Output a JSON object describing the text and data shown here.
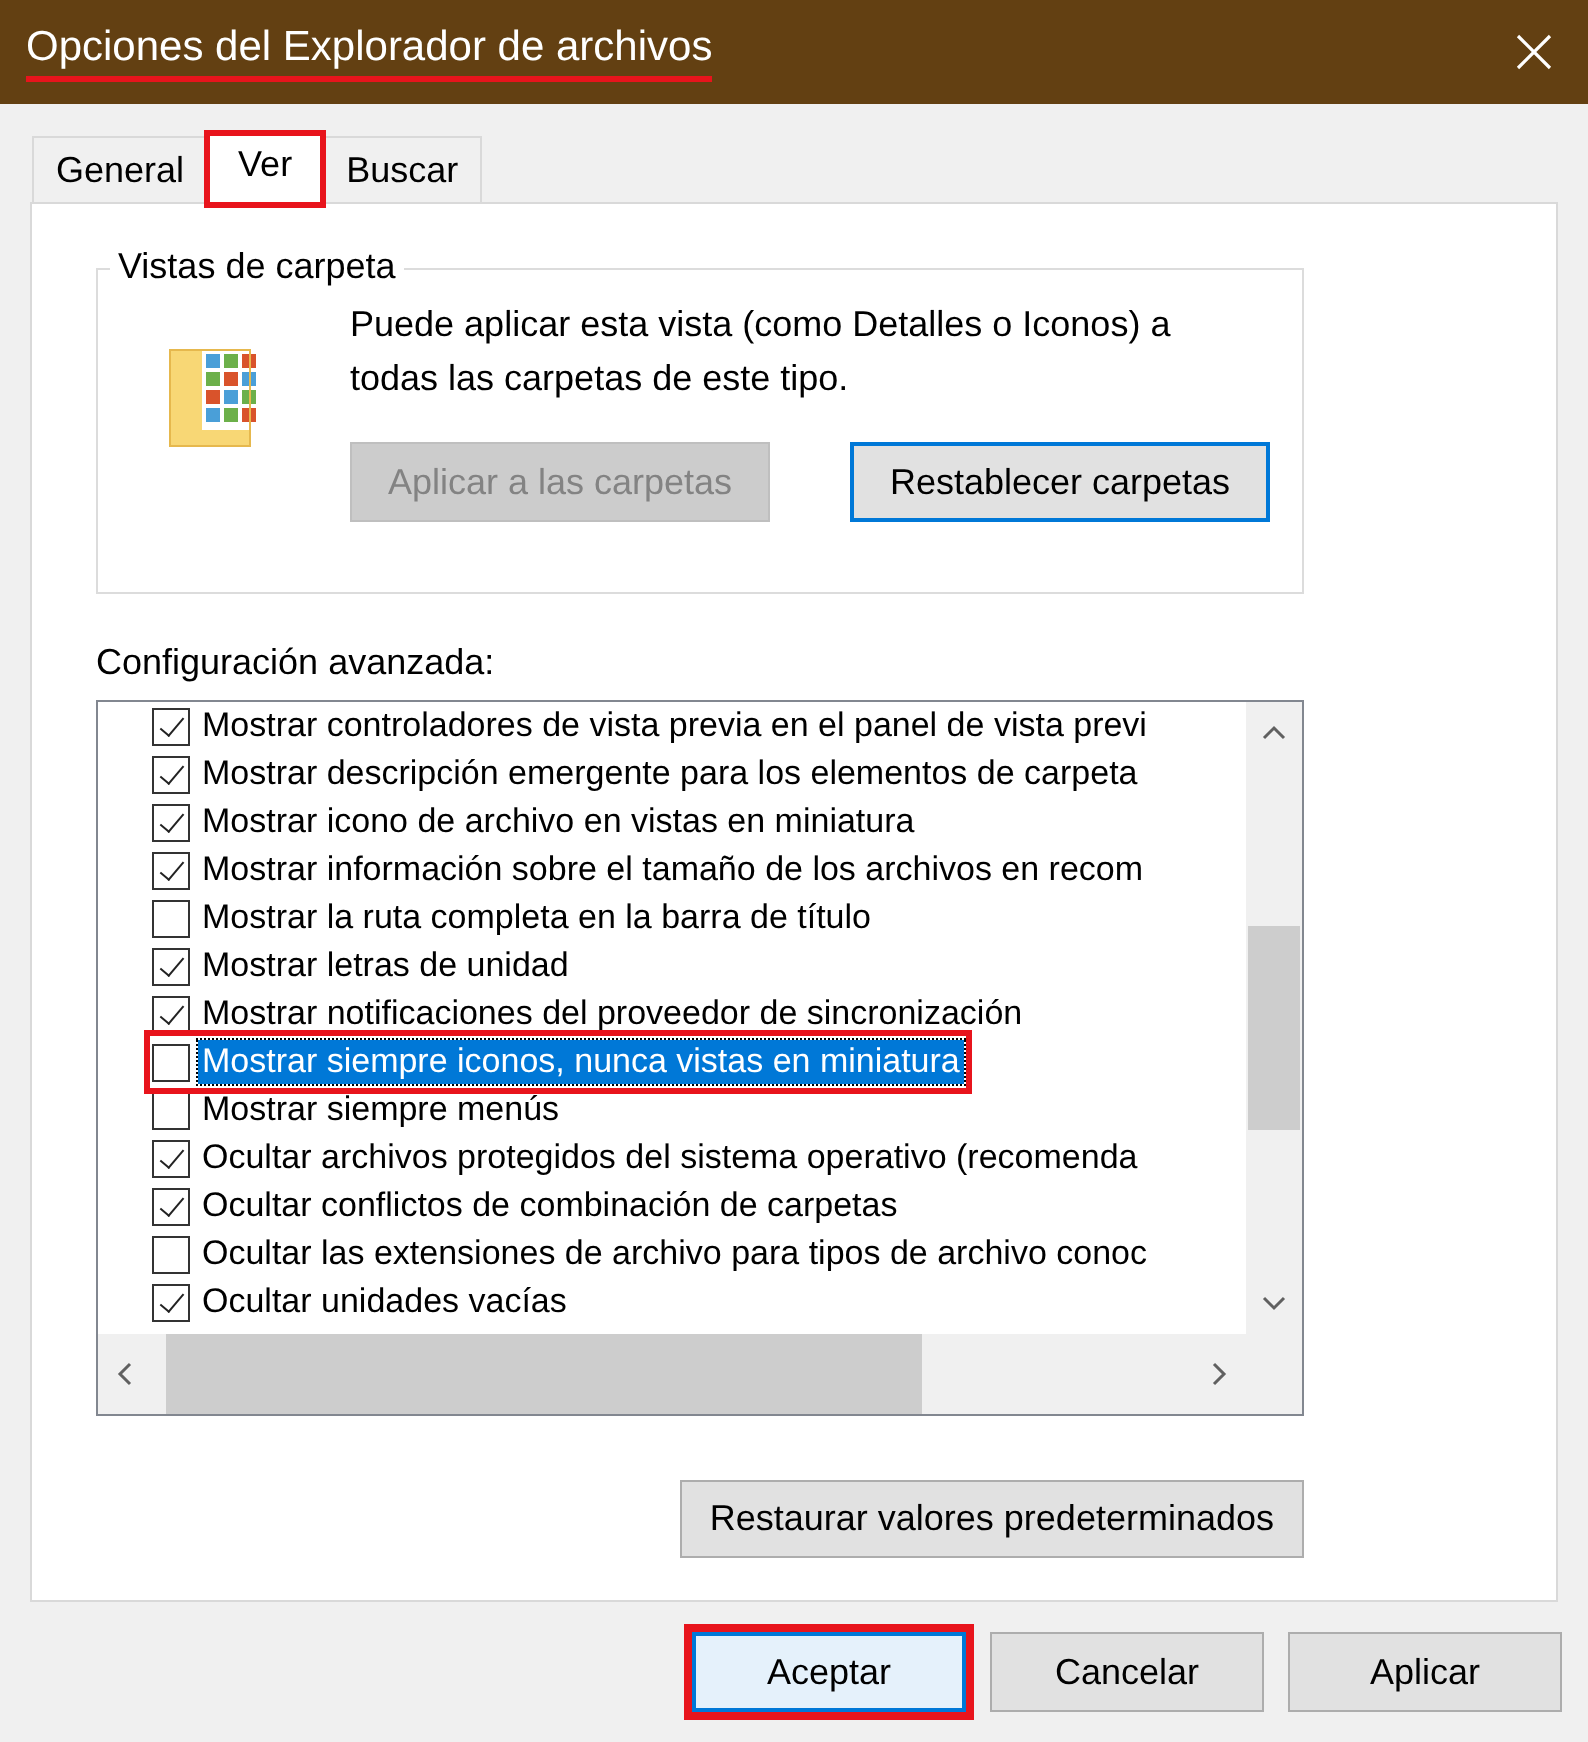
{
  "window": {
    "title": "Opciones del Explorador de archivos",
    "title_annotated": true
  },
  "tabs": [
    {
      "label": "General",
      "selected": false,
      "annotated": false
    },
    {
      "label": "Ver",
      "selected": true,
      "annotated": true
    },
    {
      "label": "Buscar",
      "selected": false,
      "annotated": false
    }
  ],
  "folder_views": {
    "title": "Vistas de carpeta",
    "description": "Puede aplicar esta vista (como Detalles o Iconos) a todas las carpetas de este tipo.",
    "buttons": [
      {
        "label": "Aplicar a las carpetas",
        "disabled": true,
        "focused": false
      },
      {
        "label": "Restablecer carpetas",
        "disabled": false,
        "focused": true
      }
    ]
  },
  "advanced": {
    "title": "Configuración avanzada:",
    "items": [
      {
        "label": "Mostrar controladores de vista previa en el panel de vista previ",
        "checked": true,
        "selected": false,
        "annotated": false
      },
      {
        "label": "Mostrar descripción emergente para los elementos de carpeta",
        "checked": true,
        "selected": false,
        "annotated": false
      },
      {
        "label": "Mostrar icono de archivo en vistas en miniatura",
        "checked": true,
        "selected": false,
        "annotated": false
      },
      {
        "label": "Mostrar información sobre el tamaño de los archivos en recom",
        "checked": true,
        "selected": false,
        "annotated": false
      },
      {
        "label": "Mostrar la ruta completa en la barra de título",
        "checked": false,
        "selected": false,
        "annotated": false
      },
      {
        "label": "Mostrar letras de unidad",
        "checked": true,
        "selected": false,
        "annotated": false
      },
      {
        "label": "Mostrar notificaciones del proveedor de sincronización",
        "checked": true,
        "selected": false,
        "annotated": false
      },
      {
        "label": "Mostrar siempre iconos, nunca vistas en miniatura",
        "checked": false,
        "selected": true,
        "annotated": true
      },
      {
        "label": "Mostrar siempre menús",
        "checked": false,
        "selected": false,
        "annotated": false
      },
      {
        "label": "Ocultar archivos protegidos del sistema operativo (recomenda",
        "checked": true,
        "selected": false,
        "annotated": false
      },
      {
        "label": "Ocultar conflictos de combinación de carpetas",
        "checked": true,
        "selected": false,
        "annotated": false
      },
      {
        "label": "Ocultar las extensiones de archivo para tipos de archivo conoc",
        "checked": false,
        "selected": false,
        "annotated": false
      },
      {
        "label": "Ocultar unidades vacías",
        "checked": true,
        "selected": false,
        "annotated": false
      }
    ]
  },
  "restore_button": "Restaurar valores predeterminados",
  "buttons": [
    {
      "label": "Aceptar",
      "default": true,
      "annotated": true
    },
    {
      "label": "Cancelar",
      "default": false,
      "annotated": false
    },
    {
      "label": "Aplicar",
      "default": false,
      "annotated": false
    }
  ]
}
